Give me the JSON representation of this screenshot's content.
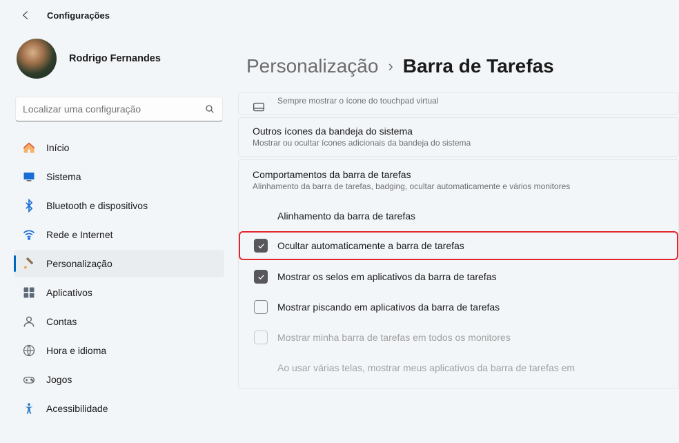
{
  "app": {
    "title": "Configurações"
  },
  "profile": {
    "name": "Rodrigo Fernandes"
  },
  "search": {
    "placeholder": "Localizar uma configuração"
  },
  "sidebar": {
    "items": [
      {
        "label": "Início"
      },
      {
        "label": "Sistema"
      },
      {
        "label": "Bluetooth e dispositivos"
      },
      {
        "label": "Rede e Internet"
      },
      {
        "label": "Personalização"
      },
      {
        "label": "Aplicativos"
      },
      {
        "label": "Contas"
      },
      {
        "label": "Hora e idioma"
      },
      {
        "label": "Jogos"
      },
      {
        "label": "Acessibilidade"
      }
    ]
  },
  "breadcrumb": {
    "parent": "Personalização",
    "sep": "›",
    "current": "Barra de Tarefas"
  },
  "cards": {
    "touchpad_sub": "Sempre mostrar o ícone do touchpad virtual",
    "tray_title": "Outros ícones da bandeja do sistema",
    "tray_sub": "Mostrar ou ocultar ícones adicionais da bandeja do sistema",
    "behav_title": "Comportamentos da barra de tarefas",
    "behav_sub": "Alinhamento da barra de tarefas, badging, ocultar automaticamente e vários monitores"
  },
  "behav": {
    "align": "Alinhamento da barra de tarefas",
    "hide": "Ocultar automaticamente a barra de tarefas",
    "badges": "Mostrar os selos em aplicativos da barra de tarefas",
    "flash": "Mostrar piscando em aplicativos da barra de tarefas",
    "allmon": "Mostrar minha barra de tarefas em todos os monitores",
    "note": "Ao usar várias telas, mostrar meus aplicativos da barra de tarefas em"
  }
}
